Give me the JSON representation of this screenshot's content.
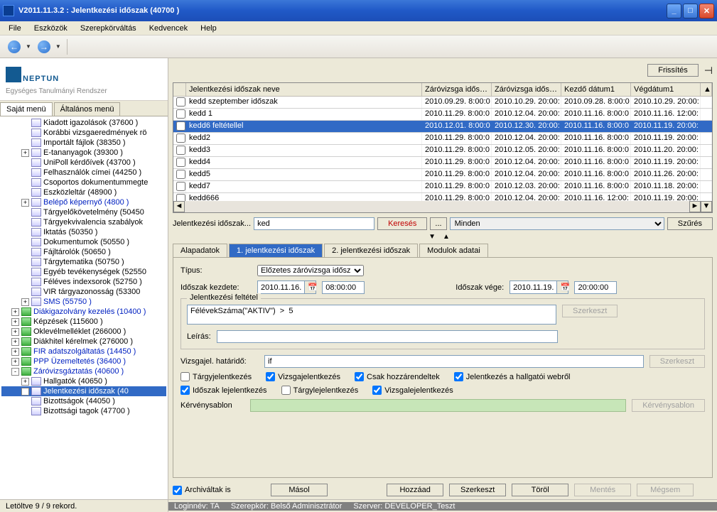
{
  "titlebar": {
    "title": "V2011.11.3.2 : Jelentkezési időszak (40700  )"
  },
  "menubar": [
    "File",
    "Eszközök",
    "Szerepkörváltás",
    "Kedvencek",
    "Help"
  ],
  "logo": {
    "brand": "NEPTUN",
    "slogan": "Egységes Tanulmányi Rendszer"
  },
  "menu_tabs": {
    "tab1": "Saját menü",
    "tab2": "Általános menü"
  },
  "tree": [
    {
      "label": "Kiadott igazolások (37600  )",
      "indent": 2,
      "exp": "",
      "icon": "form"
    },
    {
      "label": "Korábbi vizsgaeredmények rö",
      "indent": 2,
      "exp": "",
      "icon": "form"
    },
    {
      "label": "Importált fájlok (38350  )",
      "indent": 2,
      "exp": "",
      "icon": "form"
    },
    {
      "label": "E-tananyagok (39300  )",
      "indent": 2,
      "exp": "+",
      "icon": "form"
    },
    {
      "label": "UniPoll kérdőívek (43700  )",
      "indent": 2,
      "exp": "",
      "icon": "form"
    },
    {
      "label": "Felhasználók címei (44250  )",
      "indent": 2,
      "exp": "",
      "icon": "form"
    },
    {
      "label": "Csoportos dokumentummegte",
      "indent": 2,
      "exp": "",
      "icon": "form"
    },
    {
      "label": "Eszközleltár (48900  )",
      "indent": 2,
      "exp": "",
      "icon": "form"
    },
    {
      "label": "Belépő képernyő (4800  )",
      "indent": 2,
      "exp": "+",
      "icon": "form",
      "blue": true
    },
    {
      "label": "Tárgyelőkövetelmény (50450",
      "indent": 2,
      "exp": "",
      "icon": "form"
    },
    {
      "label": "Tárgyekvivalencia szabályok",
      "indent": 2,
      "exp": "",
      "icon": "form"
    },
    {
      "label": "Iktatás (50350  )",
      "indent": 2,
      "exp": "",
      "icon": "form"
    },
    {
      "label": "Dokumentumok (50550  )",
      "indent": 2,
      "exp": "",
      "icon": "form"
    },
    {
      "label": "Fájltárolók (50650  )",
      "indent": 2,
      "exp": "",
      "icon": "form"
    },
    {
      "label": "Tárgytematika (50750  )",
      "indent": 2,
      "exp": "",
      "icon": "form"
    },
    {
      "label": "Egyéb tevékenységek (52550",
      "indent": 2,
      "exp": "",
      "icon": "form"
    },
    {
      "label": "Féléves indexsorok (52750  )",
      "indent": 2,
      "exp": "",
      "icon": "form"
    },
    {
      "label": "VIR tárgyazonosság (53300",
      "indent": 2,
      "exp": "",
      "icon": "form"
    },
    {
      "label": "SMS (55750  )",
      "indent": 2,
      "exp": "+",
      "icon": "form",
      "blue": true
    },
    {
      "label": "Diákigazolvány kezelés (10400  )",
      "indent": 1,
      "exp": "+",
      "icon": "green",
      "blue": true
    },
    {
      "label": "Képzések (115600  )",
      "indent": 1,
      "exp": "+",
      "icon": "green"
    },
    {
      "label": "Oklevélmelléklet (266000  )",
      "indent": 1,
      "exp": "+",
      "icon": "green"
    },
    {
      "label": "Diákhitel kérelmek (276000  )",
      "indent": 1,
      "exp": "+",
      "icon": "green"
    },
    {
      "label": "FIR adatszolgáltatás (14450  )",
      "indent": 1,
      "exp": "+",
      "icon": "green",
      "blue": true
    },
    {
      "label": "PPP Üzemeltetés (36400  )",
      "indent": 1,
      "exp": "+",
      "icon": "green",
      "blue": true
    },
    {
      "label": "Záróvizsgáztatás (40600  )",
      "indent": 1,
      "exp": "-",
      "icon": "green",
      "blue": true
    },
    {
      "label": "Hallgatók (40650  )",
      "indent": 2,
      "exp": "+",
      "icon": "form"
    },
    {
      "label": "Jelentkezési időszak (40",
      "indent": 2,
      "exp": "+",
      "icon": "form",
      "selected": true
    },
    {
      "label": "Bizottságok (44050  )",
      "indent": 2,
      "exp": "",
      "icon": "form"
    },
    {
      "label": "Bizottsági tagok (47700  )",
      "indent": 2,
      "exp": "",
      "icon": "form"
    }
  ],
  "top_actions": {
    "refresh": "Frissítés"
  },
  "grid": {
    "headers": [
      "",
      "Jelentkezési időszak neve",
      "Záróvizsga idősza...",
      "Záróvizsga idősza...",
      "Kezdő dátum1",
      "Végdátum1"
    ],
    "rows": [
      {
        "chk": false,
        "name": "kedd szeptember időszak",
        "d1": "2010.09.29. 8:00:0",
        "d2": "2010.10.29. 20:00:",
        "d3": "2010.09.28. 8:00:0",
        "d4": "2010.10.29. 20:00:"
      },
      {
        "chk": false,
        "name": "kedd 1",
        "d1": "2010.11.29. 8:00:0",
        "d2": "2010.12.04. 20:00:",
        "d3": "2010.11.16. 8:00:0",
        "d4": "2010.11.16. 12:00:"
      },
      {
        "chk": false,
        "name": "kedd6 feltétellel",
        "sel": true,
        "d1": "2010.12.01. 8:00:0",
        "d2": "2010.12.30. 20:00:",
        "d3": "2010.11.16. 8:00:0",
        "d4": "2010.11.19. 20:00:"
      },
      {
        "chk": false,
        "name": "kedd2",
        "d1": "2010.11.29. 8:00:0",
        "d2": "2010.12.04. 20:00:",
        "d3": "2010.11.16. 8:00:0",
        "d4": "2010.11.19. 20:00:"
      },
      {
        "chk": false,
        "name": "kedd3",
        "d1": "2010.11.29. 8:00:0",
        "d2": "2010.12.05. 20:00:",
        "d3": "2010.11.16. 8:00:0",
        "d4": "2010.11.20. 20:00:"
      },
      {
        "chk": false,
        "name": "kedd4",
        "d1": "2010.11.29. 8:00:0",
        "d2": "2010.12.04. 20:00:",
        "d3": "2010.11.16. 8:00:0",
        "d4": "2010.11.19. 20:00:"
      },
      {
        "chk": false,
        "name": "kedd5",
        "d1": "2010.11.29. 8:00:0",
        "d2": "2010.12.04. 20:00:",
        "d3": "2010.11.16. 8:00:0",
        "d4": "2010.11.26. 20:00:"
      },
      {
        "chk": false,
        "name": "kedd7",
        "d1": "2010.11.29. 8:00:0",
        "d2": "2010.12.03. 20:00:",
        "d3": "2010.11.16. 8:00:0",
        "d4": "2010.11.18. 20:00:"
      },
      {
        "chk": false,
        "name": "kedd666",
        "d1": "2010.11.29. 8:00:0",
        "d2": "2010.12.04. 20:00:",
        "d3": "2010.11.16. 12:00:",
        "d4": "2010.11.19. 20:00:"
      }
    ]
  },
  "search": {
    "label": "Jelentkezési időszak...",
    "value": "ked",
    "search_btn": "Keresés",
    "ellipsis": "...",
    "filter_value": "Minden",
    "filter_btn": "Szűrés"
  },
  "detail_tabs": {
    "t1": "Alapadatok",
    "t2": "1. jelentkezési időszak",
    "t3": "2. jelentkezési időszak",
    "t4": "Modulok adatai"
  },
  "form": {
    "type_label": "Típus:",
    "type_value": "Előzetes záróvizsga idősz",
    "start_label": "Időszak kezdete:",
    "start_date": "2010.11.16.",
    "start_time": "08:00:00",
    "end_label": "Időszak vége:",
    "end_date": "2010.11.19.",
    "end_time": "20:00:00",
    "cond_legend": "Jelentkezési feltétel",
    "cond_value": "FélévekSzáma(\"AKTIV\")  >  5",
    "edit_btn": "Szerkeszt",
    "desc_label": "Leírás:",
    "deadline_label": "Vizsgajel. határidő:",
    "deadline_value": "if",
    "chk1": "Tárgyjelentkezés",
    "chk2": "Vizsgajelentkezés",
    "chk3": "Csak hozzárendeltek",
    "chk4": "Jelentkezés a hallgatói webről",
    "chk5": "Időszak lejelentkezés",
    "chk6": "Tárgylejelentkezés",
    "chk7": "Vizsgalejelentkezés",
    "reqtpl_label": "Kérvénysablon",
    "reqtpl_btn": "Kérvénysablon"
  },
  "bottom": {
    "archived": "Archiváltak is",
    "copy": "Másol",
    "add": "Hozzáad",
    "edit": "Szerkeszt",
    "delete": "Töröl",
    "save": "Mentés",
    "cancel": "Mégsem"
  },
  "status": {
    "left": "Letöltve 9 / 9 rekord.",
    "login": "Loginnév: TA",
    "role": "Szerepkör: Belső Adminisztrátor",
    "server": "Szerver: DEVELOPER_Teszt"
  }
}
